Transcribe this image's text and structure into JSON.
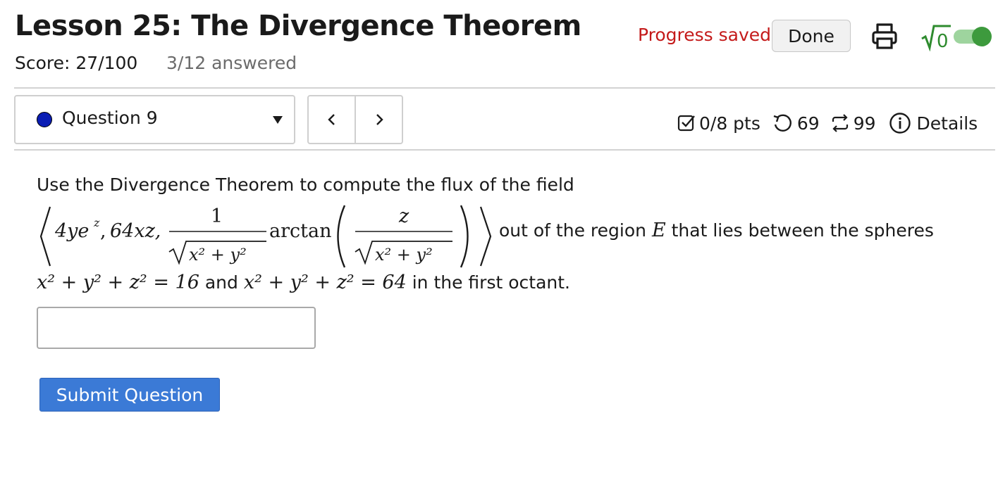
{
  "header": {
    "title": "Lesson 25: The Divergence Theorem",
    "score_label": "Score: 27/100",
    "answered_label": "3/12 answered",
    "progress_status": "Progress saved",
    "done_label": "Done",
    "icons": [
      "printer-icon",
      "sqrt-icon",
      "toggle-switch"
    ],
    "sqrt_label": "0",
    "toggle_on": true
  },
  "question_nav": {
    "selected_question": "Question 9",
    "status_color": "#0a1db4",
    "prev_label": "<",
    "next_label": ">"
  },
  "question_meta": {
    "points": "0/8 pts",
    "retries": "69",
    "attempts": "99",
    "details_label": "Details"
  },
  "question": {
    "intro_text": "Use the Divergence Theorem to compute the flux of the field",
    "field_components": {
      "c1": "4ye",
      "c1_exp": "z",
      "c2": "64xz,",
      "frac1_num": "1",
      "frac1_den": "x² + y²",
      "func": "arctan",
      "frac2_num": "z",
      "frac2_den": "x² + y²"
    },
    "region_text_1": "out of the region",
    "region_var": "E",
    "region_text_2": "that lies between the spheres",
    "sphere1": "x² + y² + z² = 16",
    "and_text": "and",
    "sphere2": "x² + y² + z² = 64",
    "tail_text": "in the first octant.",
    "answer_value": "",
    "submit_label": "Submit Question"
  },
  "colors": {
    "progress_red": "#c41a1a",
    "submit_blue": "#3b7ad6",
    "toggle_green": "#3d9a3d"
  }
}
